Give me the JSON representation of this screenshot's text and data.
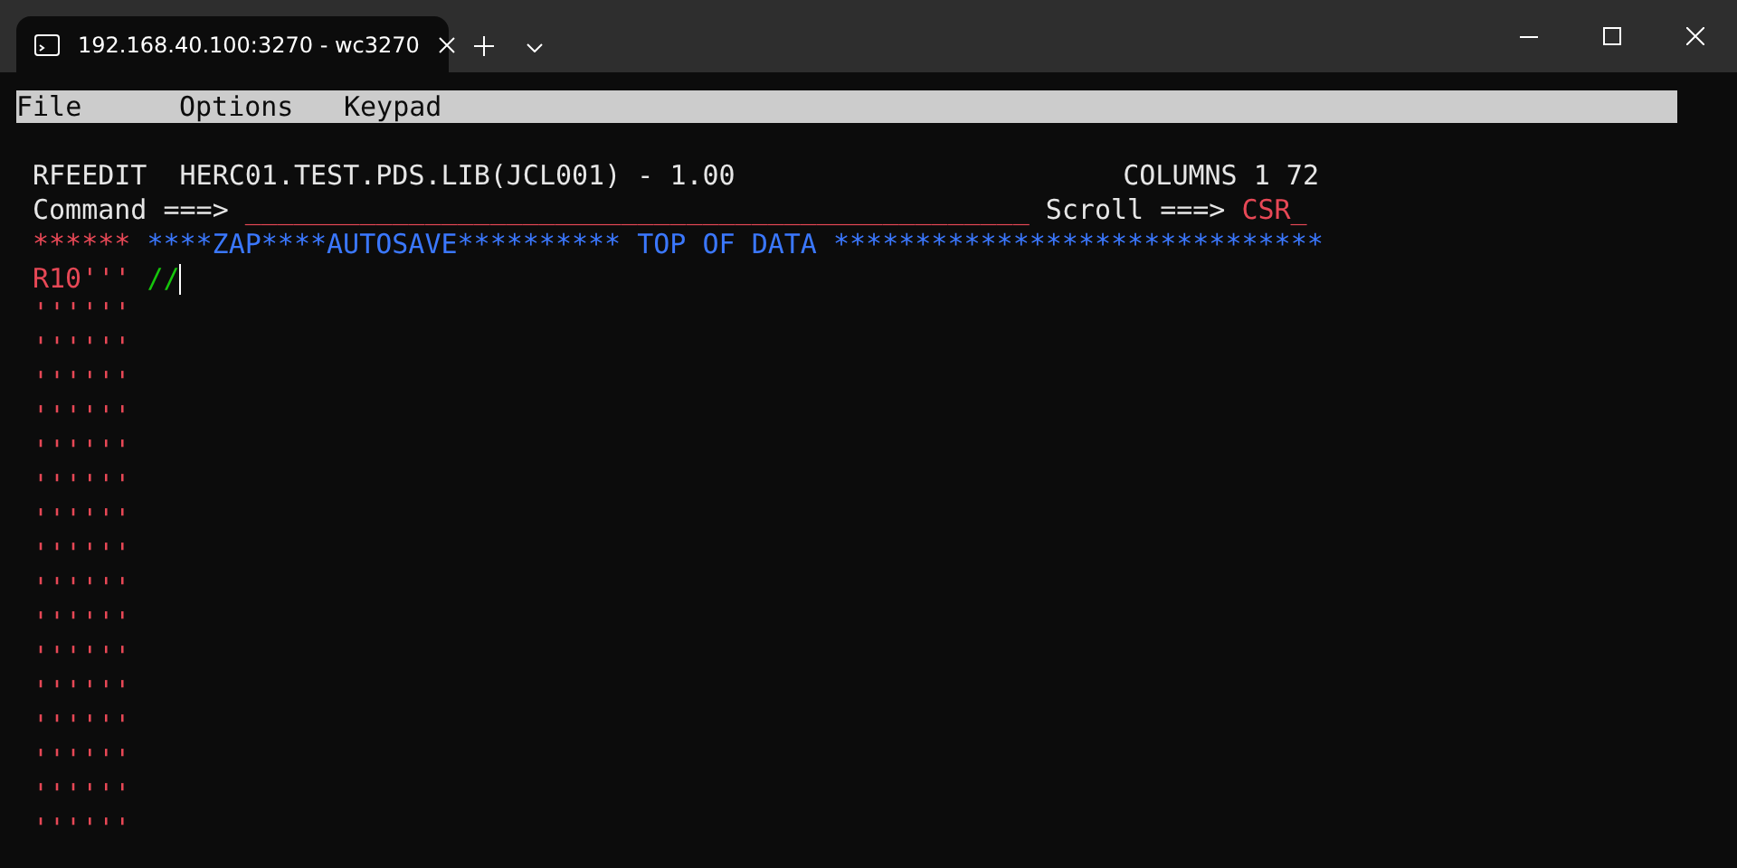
{
  "window": {
    "tab_title": "192.168.40.100:3270 - wc3270"
  },
  "menu": [
    "File",
    "Options",
    "Keypad"
  ],
  "header": {
    "title": "RFEEDIT  HERC01.TEST.PDS.LIB(JCL001) - 1.00",
    "columns": "COLUMNS 1 72"
  },
  "command": {
    "label": "Command ===>",
    "value": "________________________________________________",
    "scroll_label": "Scroll ===>",
    "scroll_value": "CSR_"
  },
  "top_line": {
    "prefix": "******",
    "text": "****ZAP****AUTOSAVE********** TOP OF DATA ******************************"
  },
  "lines": [
    {
      "prefix": "R10'''",
      "text": "//",
      "cursor": true
    },
    {
      "prefix": "''''''",
      "cursor": false
    },
    {
      "prefix": "''''''",
      "cursor": false
    },
    {
      "prefix": "''''''",
      "cursor": false
    },
    {
      "prefix": "''''''",
      "cursor": false
    },
    {
      "prefix": "''''''",
      "cursor": false
    },
    {
      "prefix": "''''''",
      "cursor": false
    },
    {
      "prefix": "''''''",
      "cursor": false
    },
    {
      "prefix": "''''''",
      "cursor": false
    },
    {
      "prefix": "''''''",
      "cursor": false
    },
    {
      "prefix": "''''''",
      "cursor": false
    },
    {
      "prefix": "''''''",
      "cursor": false
    },
    {
      "prefix": "''''''",
      "cursor": false
    },
    {
      "prefix": "''''''",
      "cursor": false
    },
    {
      "prefix": "''''''",
      "cursor": false
    },
    {
      "prefix": "''''''",
      "cursor": false
    },
    {
      "prefix": "''''''",
      "cursor": false
    }
  ]
}
